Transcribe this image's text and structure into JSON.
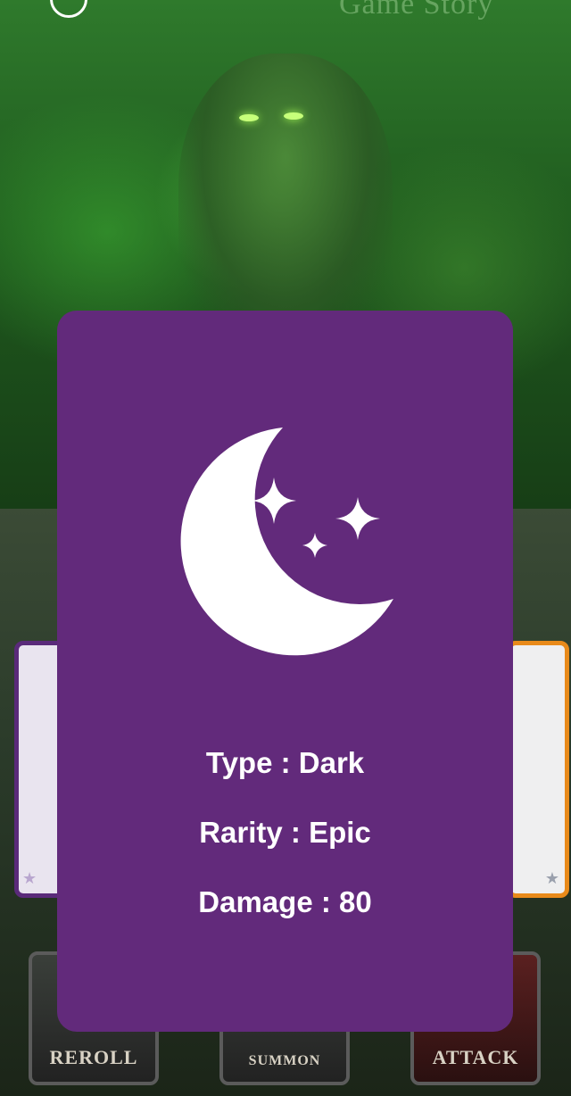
{
  "header": {
    "story_title": "Game Story",
    "menu_icon": "castle-icon"
  },
  "card": {
    "icon": "moon-stars-icon",
    "type_text": "Type : Dark",
    "rarity_text": "Rarity : Epic",
    "damage_text": "Damage : 80",
    "background_color": "#622a7b"
  },
  "buttons": {
    "reroll_label": "REROLL",
    "summon_label": "SUMMON",
    "attack_label": "ATTACK"
  }
}
